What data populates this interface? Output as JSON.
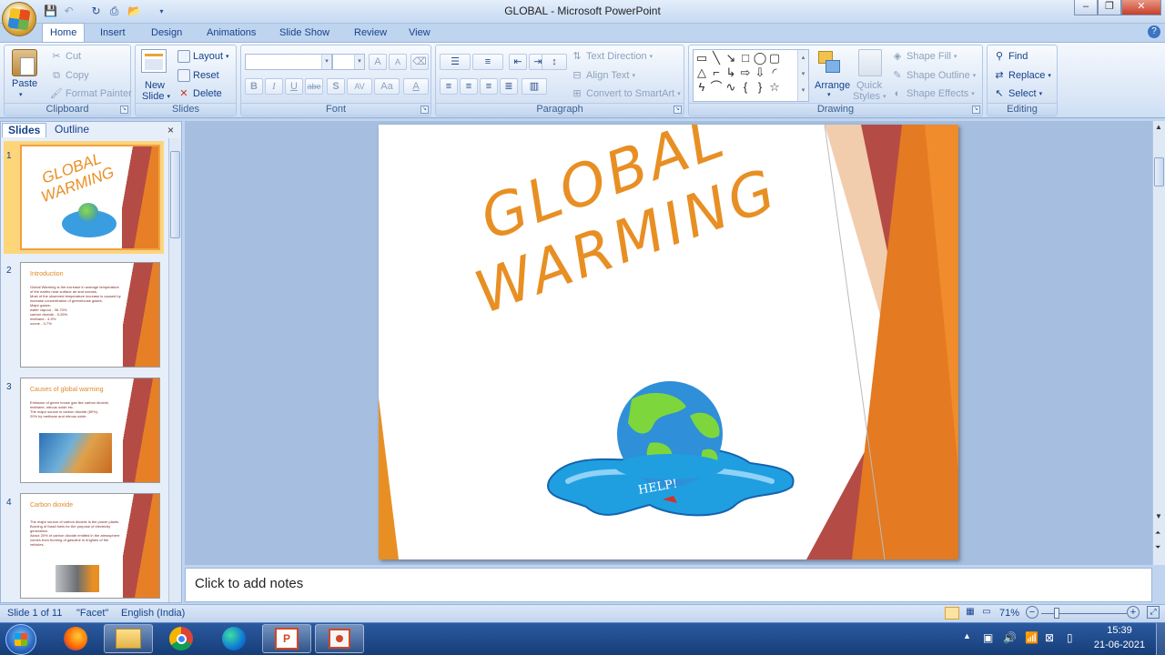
{
  "window": {
    "title": "GLOBAL - Microsoft PowerPoint",
    "min": "–",
    "max": "❐",
    "close": "✕"
  },
  "qat": {
    "save_icon": "save-icon",
    "undo_icon": "undo-icon",
    "redo_icon": "redo-icon",
    "print_icon": "print-icon",
    "open_icon": "open-icon"
  },
  "tabs": [
    "Home",
    "Insert",
    "Design",
    "Animations",
    "Slide Show",
    "Review",
    "View"
  ],
  "help_label": "?",
  "ribbon": {
    "clipboard": {
      "label": "Clipboard",
      "paste": "Paste",
      "cut": "Cut",
      "copy": "Copy",
      "format_painter": "Format Painter"
    },
    "slides": {
      "label": "Slides",
      "new_slide_1": "New",
      "new_slide_2": "Slide",
      "layout": "Layout",
      "reset": "Reset",
      "delete": "Delete"
    },
    "font": {
      "label": "Font",
      "font_name": "",
      "font_size": "",
      "grow": "A",
      "shrink": "A",
      "bold": "B",
      "italic": "I",
      "underline": "U",
      "strike": "abe",
      "shadow": "S",
      "spacing": "AV",
      "case": "Aa",
      "color": "A"
    },
    "paragraph": {
      "label": "Paragraph",
      "text_direction": "Text Direction",
      "align_text": "Align Text",
      "convert_smartart": "Convert to SmartArt"
    },
    "drawing": {
      "label": "Drawing",
      "arrange": "Arrange",
      "quick_styles_1": "Quick",
      "quick_styles_2": "Styles",
      "shape_fill": "Shape Fill",
      "shape_outline": "Shape Outline",
      "shape_effects": "Shape Effects"
    },
    "editing": {
      "label": "Editing",
      "find": "Find",
      "replace": "Replace",
      "select": "Select"
    }
  },
  "pane": {
    "tab_slides": "Slides",
    "tab_outline": "Outline",
    "close": "×"
  },
  "thumbs": [
    {
      "num": "1",
      "title": "GLOBAL WARMING",
      "bullets": []
    },
    {
      "num": "2",
      "title": "Introduction",
      "bullets": [
        "Global Warming is the increase in average temperature of the earths near surface air and oceans.",
        "Most of the observed temperature increase is caused by increase concentration of greenhouse gases.",
        "Major gases:",
        "water vapour  - 36-70%",
        "carbon dioxide - 9-26%",
        "methane - 4-9%",
        "ozone - 3-7%"
      ]
    },
    {
      "num": "3",
      "title": "Causes of global warming",
      "bullets": [
        "Emission of green house gas like carbon dioxide, methane, nitrous oxide etc.",
        "The major source is carbon dioxide (80%).",
        "20% by methane and nitrous oxide ."
      ]
    },
    {
      "num": "4",
      "title": "Carbon dioxide",
      "bullets": [
        "The major source of carbon dioxide is the power plants.",
        "Burning of fossil fuels for the purpose of electricity generation.",
        "About 20% of carbon dioxide emitted in the atmosphere comes from burning of gasoline in engines of the vehicles."
      ]
    }
  ],
  "slide": {
    "title_line1": "GLOBAL",
    "title_line2": "WARMING",
    "image_label": "HELP!"
  },
  "notes": {
    "placeholder": "Click to add notes"
  },
  "status": {
    "slide_info": "Slide 1 of 11",
    "theme": "\"Facet\"",
    "language": "English (India)",
    "zoom": "71%",
    "zoom_minus": "−",
    "zoom_plus": "+"
  },
  "taskbar": {
    "time": "15:39",
    "date": "21-06-2021"
  },
  "colors": {
    "accent_orange": "#e88f24",
    "accent_red": "#b44c45",
    "ribbon_text": "#15428b"
  }
}
